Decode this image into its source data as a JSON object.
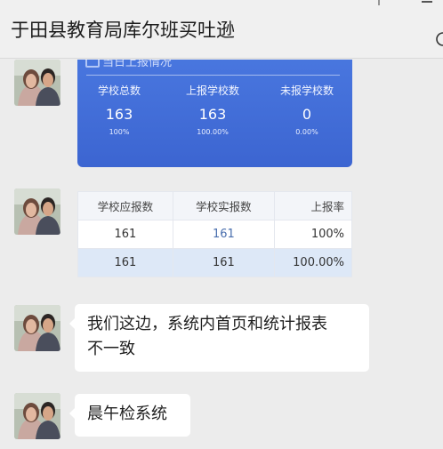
{
  "header": {
    "title": "于田县教育局库尔班买吐逊"
  },
  "report_card": {
    "header": "当日上报情况",
    "stats": [
      {
        "label": "学校总数",
        "value": "163",
        "percent": "100%"
      },
      {
        "label": "上报学校数",
        "value": "163",
        "percent": "100.00%"
      },
      {
        "label": "未报学校数",
        "value": "0",
        "percent": "0.00%"
      }
    ]
  },
  "report_table": {
    "headers": [
      "学校应报数",
      "学校实报数",
      "上报率"
    ],
    "rows": [
      [
        "161",
        "161",
        "100%"
      ],
      [
        "161",
        "161",
        "100.00%"
      ]
    ]
  },
  "messages": [
    {
      "text": "我们这边，系统内首页和统计报表\n不一致"
    },
    {
      "text": "晨午检系统"
    }
  ],
  "colors": {
    "card_blue": "#3f6ad6",
    "highlight_row": "#dde8f7",
    "bubble": "#ffffff"
  }
}
